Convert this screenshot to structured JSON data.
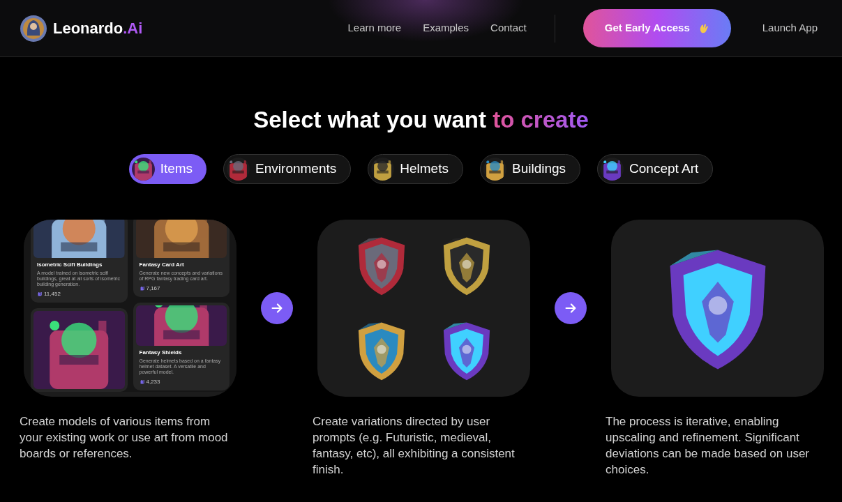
{
  "header": {
    "logo": {
      "name": "Leonardo",
      "suffix": ".Ai"
    },
    "nav": [
      "Learn more",
      "Examples",
      "Contact"
    ],
    "cta": "Get Early Access",
    "launch": "Launch App"
  },
  "heading": {
    "text": "Select what you want",
    "accent": "to create"
  },
  "categories": [
    {
      "label": "Items",
      "selected": true
    },
    {
      "label": "Environments",
      "selected": false
    },
    {
      "label": "Helmets",
      "selected": false
    },
    {
      "label": "Buildings",
      "selected": false
    },
    {
      "label": "Concept Art",
      "selected": false
    }
  ],
  "steps": [
    {
      "kind": "models",
      "caption": "Create models of various items from your existing work or use art from mood boards or references.",
      "columns": [
        [
          {
            "title": "Isometric Scifi Buildings",
            "description": "A model trained on isometric scifi buildings, great at all sorts of isometric building generation.",
            "count": "11,452"
          },
          {
            "kind": "picture"
          }
        ],
        [
          {
            "title": "Fantasy Card Art",
            "description": "Generate new concepts and variations of RPG fantasy trading card art.",
            "count": "7,167"
          },
          {
            "title": "Fantasy Shields",
            "description": "Generate helmets based on a fantasy helmet dataset. A versatile and powerful model.",
            "count": "4,233"
          }
        ]
      ]
    },
    {
      "kind": "grid",
      "caption": "Create variations directed by user prompts (e.g. Futuristic, medieval, fantasy, etc), all exhibiting a consistent finish."
    },
    {
      "kind": "single",
      "caption": "The process is iterative, enabling upscaling and refinement. Significant deviations can be made based on user choices."
    }
  ]
}
